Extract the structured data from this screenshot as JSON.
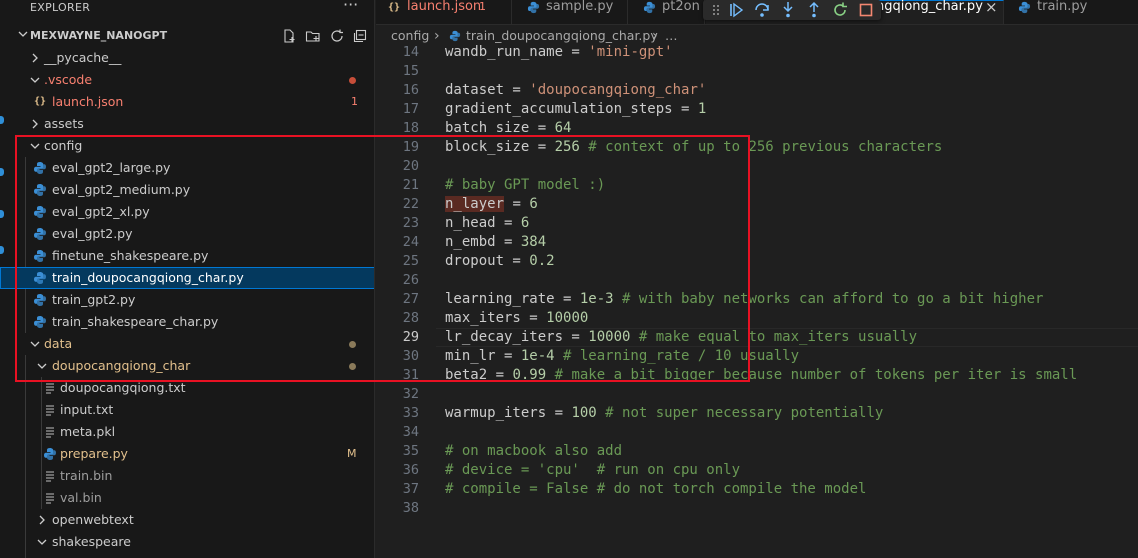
{
  "explorer": {
    "title": "EXPLORER",
    "more": "···",
    "project": "MEXWAYNE_NANOGPT"
  },
  "tree": {
    "pycache": "__pycache__",
    "vscode": ".vscode",
    "launch_json": "launch.json",
    "launch_badge": "1",
    "assets": "assets",
    "config": "config",
    "config_files": [
      "eval_gpt2_large.py",
      "eval_gpt2_medium.py",
      "eval_gpt2_xl.py",
      "eval_gpt2.py",
      "finetune_shakespeare.py",
      "train_doupocangqiong_char.py",
      "train_gpt2.py",
      "train_shakespeare_char.py"
    ],
    "data": "data",
    "doupo_folder": "doupocangqiong_char",
    "doupo_files": [
      "doupocangqiong.txt",
      "input.txt",
      "meta.pkl",
      "prepare.py",
      "train.bin",
      "val.bin"
    ],
    "prepare_badge": "M",
    "openwebtext": "openwebtext",
    "shakespeare": "shakespeare"
  },
  "tabs": [
    {
      "label": "launch.json",
      "badge": "1",
      "icon": "json-icon"
    },
    {
      "label": "sample.py",
      "icon": "python-icon"
    },
    {
      "label": "pt2on",
      "icon": "python-icon"
    },
    {
      "label": "ngqiong_char.py",
      "icon": "python-icon",
      "close": "×"
    },
    {
      "label": "train.py",
      "icon": "python-icon"
    }
  ],
  "breadcrumb": {
    "folder": "config",
    "sep": "›",
    "file": "train_doupocangqiong_char.py",
    "more": "…"
  },
  "editor": {
    "current_line": 29,
    "lines": [
      {
        "n": "14",
        "parts": [
          [
            "wandb_run_name = ",
            ""
          ],
          [
            "'mini-gpt'",
            "str"
          ]
        ]
      },
      {
        "n": "15",
        "parts": []
      },
      {
        "n": "16",
        "parts": [
          [
            "dataset = ",
            ""
          ],
          [
            "'doupocangqiong_char'",
            "str"
          ]
        ]
      },
      {
        "n": "17",
        "parts": [
          [
            "gradient_accumulation_steps = ",
            ""
          ],
          [
            "1",
            "num"
          ]
        ]
      },
      {
        "n": "18",
        "parts": [
          [
            "batch_size = ",
            ""
          ],
          [
            "64",
            "num"
          ]
        ]
      },
      {
        "n": "19",
        "parts": [
          [
            "block_size = ",
            ""
          ],
          [
            "256",
            "num"
          ],
          [
            " # context of up to 256 previous characters",
            "com"
          ]
        ]
      },
      {
        "n": "20",
        "parts": []
      },
      {
        "n": "21",
        "parts": [
          [
            "# baby GPT model :)",
            "com"
          ]
        ]
      },
      {
        "n": "22",
        "parts": [
          [
            "n_layer",
            "hl"
          ],
          [
            " = ",
            ""
          ],
          [
            "6",
            "num"
          ]
        ]
      },
      {
        "n": "23",
        "parts": [
          [
            "n_head = ",
            ""
          ],
          [
            "6",
            "num"
          ]
        ]
      },
      {
        "n": "24",
        "parts": [
          [
            "n_embd = ",
            ""
          ],
          [
            "384",
            "num"
          ]
        ]
      },
      {
        "n": "25",
        "parts": [
          [
            "dropout = ",
            ""
          ],
          [
            "0.2",
            "num"
          ]
        ]
      },
      {
        "n": "26",
        "parts": []
      },
      {
        "n": "27",
        "parts": [
          [
            "learning_rate = ",
            ""
          ],
          [
            "1e-3",
            "num"
          ],
          [
            " # with baby networks can afford to go a bit higher",
            "com"
          ]
        ]
      },
      {
        "n": "28",
        "parts": [
          [
            "max_iters = ",
            ""
          ],
          [
            "10000",
            "num"
          ]
        ]
      },
      {
        "n": "29",
        "parts": [
          [
            "lr_decay_iters = ",
            ""
          ],
          [
            "10000",
            "num"
          ],
          [
            " # make equal to max_iters usually",
            "com"
          ]
        ]
      },
      {
        "n": "30",
        "parts": [
          [
            "min_lr = ",
            ""
          ],
          [
            "1e-4",
            "num"
          ],
          [
            " # learning_rate / 10 usually",
            "com"
          ]
        ]
      },
      {
        "n": "31",
        "parts": [
          [
            "beta2 = ",
            ""
          ],
          [
            "0.99",
            "num"
          ],
          [
            " # make a bit bigger because number of tokens per iter is small",
            "com"
          ]
        ]
      },
      {
        "n": "32",
        "parts": []
      },
      {
        "n": "33",
        "parts": [
          [
            "warmup_iters = ",
            ""
          ],
          [
            "100",
            "num"
          ],
          [
            " # not super necessary potentially",
            "com"
          ]
        ]
      },
      {
        "n": "34",
        "parts": []
      },
      {
        "n": "35",
        "parts": [
          [
            "# on macbook also add",
            "com"
          ]
        ]
      },
      {
        "n": "36",
        "parts": [
          [
            "# device = 'cpu'  # run on cpu only",
            "com"
          ]
        ]
      },
      {
        "n": "37",
        "parts": [
          [
            "# compile = False # do not torch compile the model",
            "com"
          ]
        ]
      },
      {
        "n": "38",
        "parts": []
      }
    ]
  },
  "colors": {
    "accent": "#0078d4",
    "annotation": "#e81123",
    "python_icon": "#3b8fd6",
    "error_red": "#f14c4c",
    "modified": "#e2c08d"
  }
}
